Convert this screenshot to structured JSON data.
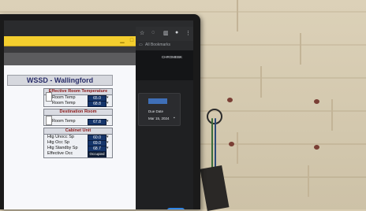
{
  "scada": {
    "title": "WSSD - Wallingford",
    "effective_room_temperature": {
      "header": "Effective Room Temperature",
      "rows": [
        {
          "label": "Room Temp",
          "value": "65.0"
        },
        {
          "label": "Room Temp",
          "value": "68.8"
        }
      ]
    },
    "destination_room": {
      "header": "Destination Room",
      "rows": [
        {
          "label": "Room Temp",
          "value": "67.8"
        }
      ]
    },
    "cabinet_unit": {
      "header": "Cabinet Unit",
      "rows": [
        {
          "label": "Htg Unocc Sp",
          "value": "60.0"
        },
        {
          "label": "Htg Occ Sp",
          "value": "69.0"
        },
        {
          "label": "Htg Standby Sp",
          "value": "68.7"
        },
        {
          "label": "Effective Occ",
          "value": "Occupied"
        }
      ]
    },
    "title_buttons": [
      "▁",
      "□",
      "✕"
    ]
  },
  "browser": {
    "bookmarks_label": "All Bookmarks",
    "profile_label": "CHROMEBK",
    "due_date_label": "Due Date",
    "due_date_value": "Mar 15, 2024"
  },
  "colors": {
    "titlebar": "#f4ce2e",
    "value_box": "#15356b",
    "accent_blue": "#2f86e8"
  }
}
